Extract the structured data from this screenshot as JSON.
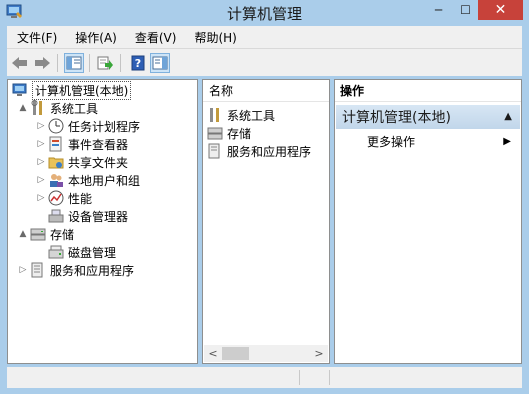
{
  "window": {
    "title": "计算机管理"
  },
  "caption": {
    "minimize": "─",
    "maximize": "☐",
    "close": "✕"
  },
  "menu": {
    "items": [
      "文件(F)",
      "操作(A)",
      "查看(V)",
      "帮助(H)"
    ]
  },
  "tree": {
    "items": [
      {
        "label": "计算机管理(本地)",
        "icon": "computer-management-icon",
        "expander": ""
      },
      {
        "label": "系统工具",
        "icon": "tools-icon",
        "expander": "▲"
      },
      {
        "label": "任务计划程序",
        "icon": "clock-icon",
        "expander": "▷"
      },
      {
        "label": "事件查看器",
        "icon": "event-viewer-icon",
        "expander": "▷"
      },
      {
        "label": "共享文件夹",
        "icon": "shared-folder-icon",
        "expander": "▷"
      },
      {
        "label": "本地用户和组",
        "icon": "users-icon",
        "expander": "▷"
      },
      {
        "label": "性能",
        "icon": "performance-icon",
        "expander": "▷"
      },
      {
        "label": "设备管理器",
        "icon": "device-manager-icon",
        "expander": ""
      },
      {
        "label": "存储",
        "icon": "storage-icon",
        "expander": "▲"
      },
      {
        "label": "磁盘管理",
        "icon": "disk-icon",
        "expander": ""
      },
      {
        "label": "服务和应用程序",
        "icon": "services-icon",
        "expander": "▷"
      }
    ]
  },
  "list": {
    "header": "名称",
    "items": [
      {
        "label": "系统工具",
        "icon": "tools-icon"
      },
      {
        "label": "存储",
        "icon": "storage-icon"
      },
      {
        "label": "服务和应用程序",
        "icon": "services-icon"
      }
    ],
    "scroll_left": "<",
    "scroll_right": ">"
  },
  "actions": {
    "header": "操作",
    "section": "计算机管理(本地)",
    "section_arrow": "▲",
    "more": "更多操作",
    "more_arrow": "▶"
  },
  "colors": {
    "close_button": "#c7423a",
    "frame": "#aacdea",
    "section": "#c9dcee"
  }
}
